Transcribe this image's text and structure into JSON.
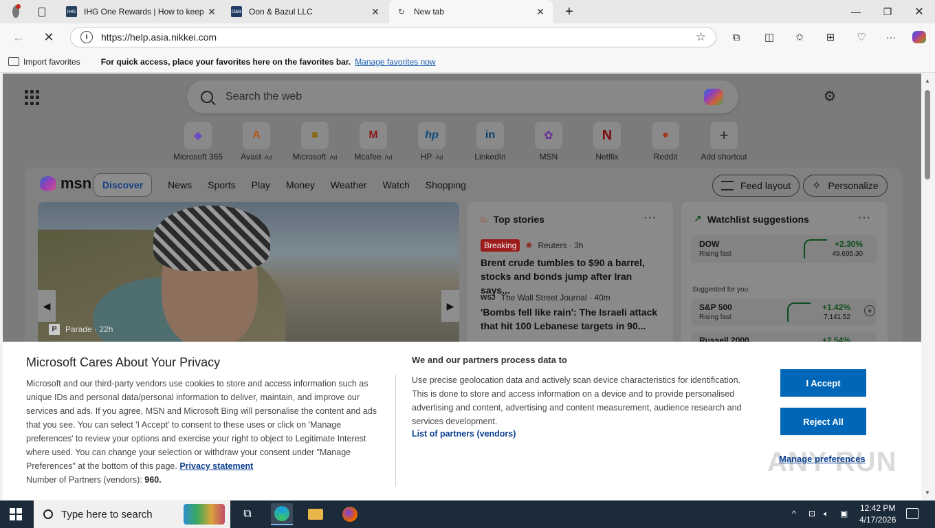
{
  "tabs": [
    {
      "title": "IHG One Rewards | How to keep y",
      "favicon": "ihg-favicon",
      "favicon_text": "IHG"
    },
    {
      "title": "Oon & Bazul LLC",
      "favicon": "ob-favicon",
      "favicon_text": "O&B"
    },
    {
      "title": "New tab",
      "favicon": "loading-icon"
    }
  ],
  "address": {
    "url": "https://help.asia.nikkei.com"
  },
  "favorites_bar": {
    "import_label": "Import favorites",
    "message": "For quick access, place your favorites here on the favorites bar.",
    "manage_link": "Manage favorites now"
  },
  "newtab": {
    "search_placeholder": "Search the web",
    "shortcuts": [
      {
        "label": "Microsoft 365",
        "ad": "",
        "icon": "◆"
      },
      {
        "label": "Avast",
        "ad": "· Ad",
        "icon": "A"
      },
      {
        "label": "Microsoft",
        "ad": "· Ad",
        "icon": "■"
      },
      {
        "label": "Mcafee",
        "ad": "· Ad",
        "icon": "M"
      },
      {
        "label": "HP",
        "ad": "· Ad",
        "icon": "hp"
      },
      {
        "label": "LinkedIn",
        "ad": "",
        "icon": "in"
      },
      {
        "label": "MSN",
        "ad": "",
        "icon": "✿"
      },
      {
        "label": "Netflix",
        "ad": "",
        "icon": "N"
      },
      {
        "label": "Reddit",
        "ad": "",
        "icon": "●"
      },
      {
        "label": "Add shortcut",
        "ad": "",
        "icon": "+"
      }
    ]
  },
  "feed": {
    "logo_text": "msn",
    "tabs": [
      "Discover",
      "News",
      "Sports",
      "Play",
      "Money",
      "Weather",
      "Watch",
      "Shopping"
    ],
    "feed_layout_label": "Feed layout",
    "personalize_label": "Personalize",
    "hero": {
      "source": "Parade",
      "time": "· 22h",
      "source_icon": "P"
    },
    "top_stories": {
      "title": "Top stories",
      "stories": [
        {
          "badge": "Breaking",
          "source": "Reuters · 3h",
          "title": "Brent crude tumbles to $90 a barrel, stocks and bonds jump after Iran says..."
        },
        {
          "source_icon": "WSJ",
          "source": "The Wall Street Journal · 40m",
          "title": "'Bombs fell like rain': The Israeli attack that hit 100 Lebanese targets in 90..."
        }
      ]
    },
    "watchlist": {
      "title": "Watchlist suggestions",
      "suggested_label": "Suggested for you",
      "rows": [
        {
          "symbol": "DOW",
          "sub": "Rising fast",
          "change": "+2.30%",
          "price": "49,695.30"
        },
        {
          "symbol": "S&P 500",
          "sub": "Rising fast",
          "change": "+1.42%",
          "price": "7,141.52"
        },
        {
          "symbol": "Russell 2000",
          "sub": "",
          "change": "+2.54%",
          "price": ""
        }
      ]
    }
  },
  "privacy": {
    "title": "Microsoft Cares About Your Privacy",
    "body": "Microsoft and our third-party vendors use cookies to store and access information such as unique IDs and personal data/personal information to deliver, maintain, and improve our services and ads. If you agree, MSN and Microsoft Bing will personalise the content and ads that you see. You can select 'I Accept' to consent to these uses or click on 'Manage preferences' to review your options and exercise your right to object to Legitimate Interest where used. You can change your selection or withdraw your consent under \"Manage Preferences\" at the bottom of this page.",
    "privacy_link": "Privacy statement",
    "partners_label": "Number of Partners (vendors):",
    "partners_count": "960.",
    "right_title": "We and our partners process data to",
    "right_body": "Use precise geolocation data and actively scan device characteristics for identification. This is done to store and access information on a device and to provide personalised advertising and content, advertising and content measurement, audience research and services development.",
    "partners_link": "List of partners (vendors)",
    "accept_label": "I Accept",
    "reject_label": "Reject All",
    "manage_label": "Manage preferences",
    "watermark": "ANY RUN"
  },
  "taskbar": {
    "search_placeholder": "Type here to search",
    "time": "12:42 PM",
    "date": "4/17/2026"
  }
}
